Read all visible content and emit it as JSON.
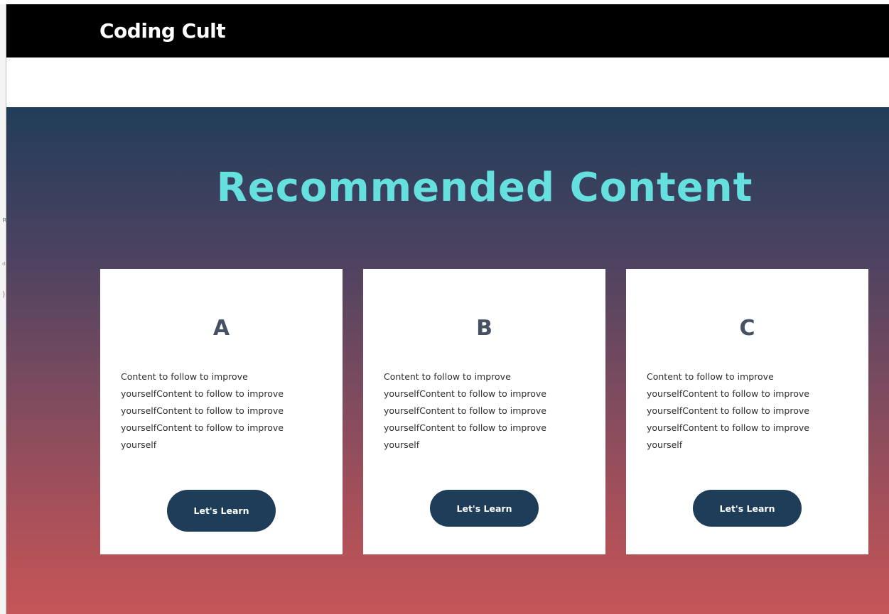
{
  "header": {
    "brand": "Coding Cult"
  },
  "hero": {
    "title": "Recommended Content"
  },
  "cards": [
    {
      "letter": "A",
      "text": "Content to follow to improve yourselfContent to follow to improve yourselfContent to follow to improve yourselfContent to follow to improve yourself",
      "button_label": "Let's Learn"
    },
    {
      "letter": "B",
      "text": "Content to follow to improve yourselfContent to follow to improve yourselfContent to follow to improve yourselfContent to follow to improve yourself",
      "button_label": "Let's Learn"
    },
    {
      "letter": "C",
      "text": "Content to follow to improve yourselfContent to follow to improve yourselfContent to follow to improve yourselfContent to follow to improve yourself",
      "button_label": "Let's Learn"
    }
  ],
  "colors": {
    "header_bg": "#000000",
    "title_accent": "#66e0de",
    "gradient_top": "#213d59",
    "gradient_bottom": "#c55558",
    "button_bg": "#1e3d58",
    "card_letter": "#465263"
  }
}
